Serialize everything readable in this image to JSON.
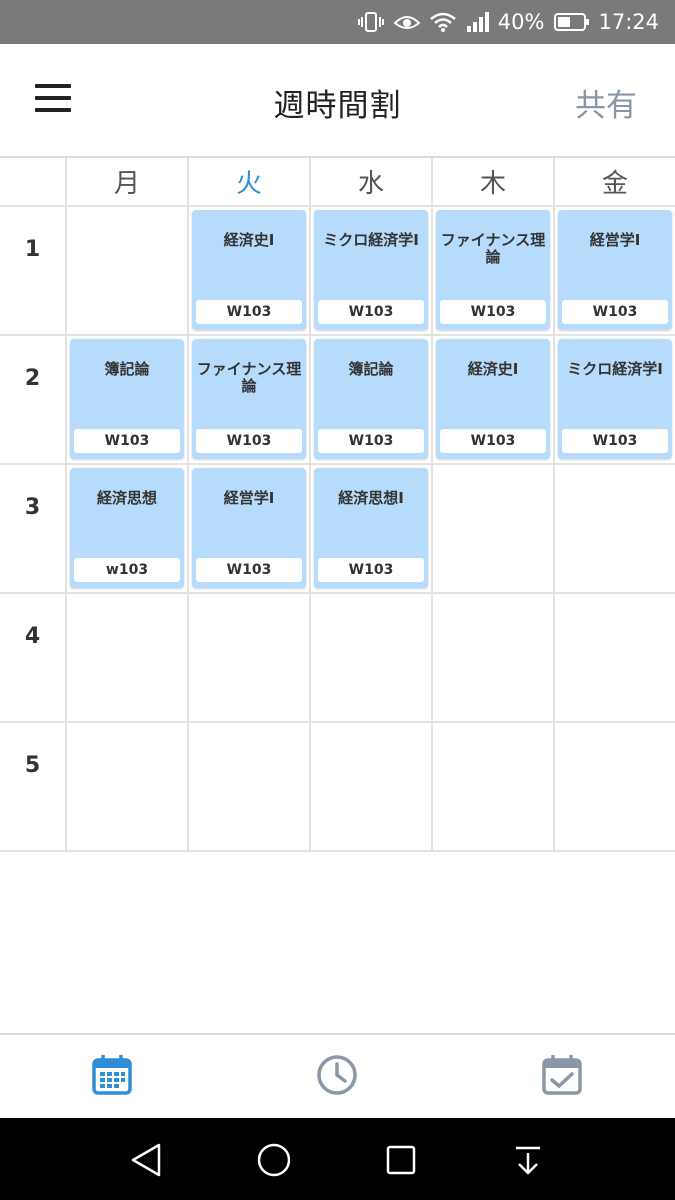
{
  "status_bar": {
    "battery": "40%",
    "time": "17:24"
  },
  "header": {
    "title": "週時間割",
    "share_label": "共有"
  },
  "days": [
    "月",
    "火",
    "水",
    "木",
    "金"
  ],
  "periods": [
    {
      "label": "1",
      "slots": [
        null,
        {
          "name": "経済史I",
          "room": "W103"
        },
        {
          "name": "ミクロ経済学I",
          "room": "W103"
        },
        {
          "name": "ファイナンス理論",
          "room": "W103"
        },
        {
          "name": "経営学I",
          "room": "W103"
        }
      ]
    },
    {
      "label": "2",
      "slots": [
        {
          "name": "簿記論",
          "room": "W103"
        },
        {
          "name": "ファイナンス理論",
          "room": "W103"
        },
        {
          "name": "簿記論",
          "room": "W103"
        },
        {
          "name": "経済史I",
          "room": "W103"
        },
        {
          "name": "ミクロ経済学I",
          "room": "W103"
        }
      ]
    },
    {
      "label": "3",
      "slots": [
        {
          "name": "経済思想",
          "room": "w103"
        },
        {
          "name": "経営学I",
          "room": "W103"
        },
        {
          "name": "経済思想I",
          "room": "W103"
        },
        null,
        null
      ]
    },
    {
      "label": "4",
      "slots": [
        null,
        null,
        null,
        null,
        null
      ]
    },
    {
      "label": "5",
      "slots": [
        null,
        null,
        null,
        null,
        null
      ]
    }
  ],
  "colors": {
    "accent": "#2e8fd6",
    "course_bg": "#b7dcfb",
    "nav_active": "#2e8fd6",
    "nav_inactive": "#8a97a6"
  },
  "bottom_nav": [
    {
      "icon": "calendar-icon",
      "active": true
    },
    {
      "icon": "clock-icon",
      "active": false
    },
    {
      "icon": "calendar-check-icon",
      "active": false
    }
  ],
  "system_nav": [
    "back-icon",
    "home-icon",
    "recents-icon",
    "notification-pull-icon"
  ]
}
